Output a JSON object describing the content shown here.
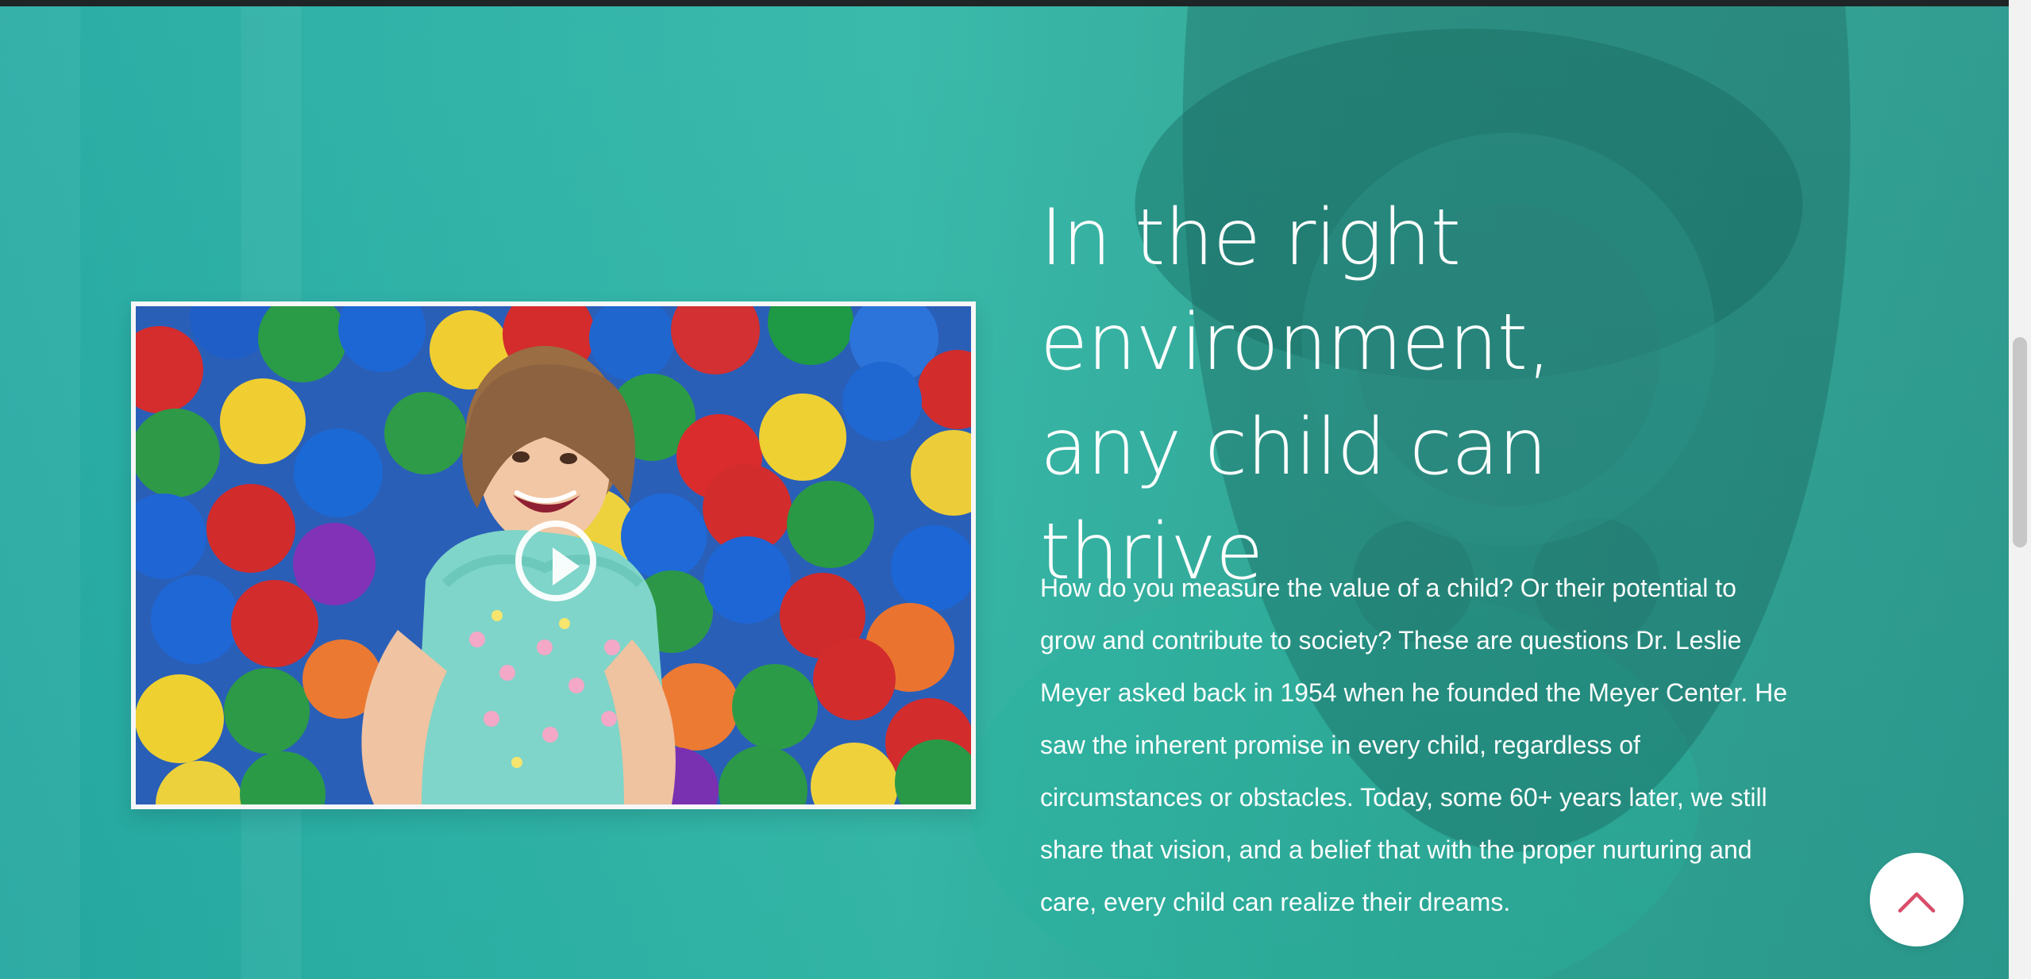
{
  "hero": {
    "headline": "In the right environment, any child can thrive",
    "body": "How do you measure the value of a child? Or their potential to grow and contribute to society? These are questions Dr. Leslie Meyer asked back in 1954 when he founded the Meyer Center. He saw the inherent promise in every child, regardless of circumstances or obstacles. Today, some 60+ years later, we still share that vision, and a belief that with the proper nurturing and care, every child can realize their dreams.",
    "background_color": "#2bb1a6"
  },
  "video": {
    "play_icon": "play-icon"
  },
  "navigation": {
    "back_to_top_icon": "chevron-up-icon",
    "accent_color": "#d94d6a"
  },
  "ui": {
    "scrollbar": true
  }
}
